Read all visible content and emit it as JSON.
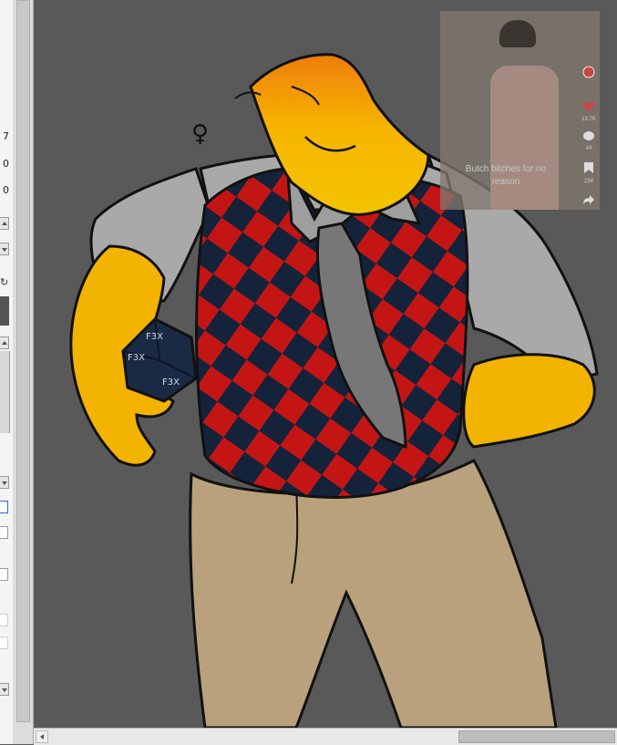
{
  "left_panel": {
    "values": [
      "7",
      "0",
      "0"
    ]
  },
  "reference_overlay": {
    "caption": "Butch bitches for no reason",
    "side_icons": [
      {
        "icon": "like-icon",
        "count": "13.7K"
      },
      {
        "icon": "comment-icon",
        "count": "44"
      },
      {
        "icon": "bookmark-icon",
        "count": "234"
      },
      {
        "icon": "share-icon",
        "count": ""
      }
    ]
  },
  "artwork": {
    "dice_inscriptions": [
      "F3X",
      "F3X",
      "F3X"
    ],
    "symbol": "♀"
  },
  "colors": {
    "canvas_bg": "#595959",
    "skin": "#f2b400",
    "vest_red": "#c41515",
    "vest_navy": "#14233a",
    "shirt": "#a9a9a9",
    "pants": "#b8a17c"
  }
}
